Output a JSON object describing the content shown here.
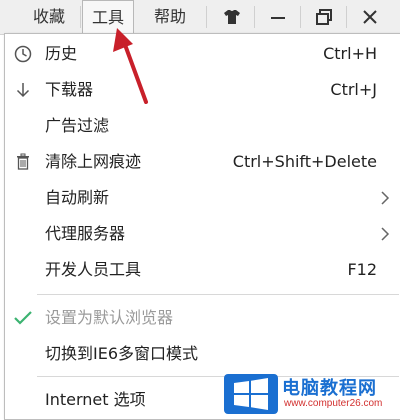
{
  "menubar": {
    "items": [
      {
        "label": "收藏"
      },
      {
        "label": "工具"
      },
      {
        "label": "帮助"
      }
    ],
    "window_buttons": [
      "shirt-icon",
      "minimize-icon",
      "restore-icon",
      "close-icon"
    ]
  },
  "dropdown": {
    "items": [
      {
        "label": "历史",
        "shortcut": "Ctrl+H",
        "icon": "clock-icon"
      },
      {
        "label": "下载器",
        "shortcut": "Ctrl+J",
        "icon": "download-arrow-icon"
      },
      {
        "label": "广告过滤",
        "shortcut": ""
      },
      {
        "label": "清除上网痕迹",
        "shortcut": "Ctrl+Shift+Delete",
        "icon": "trash-icon"
      },
      {
        "label": "自动刷新",
        "shortcut": "",
        "submenu": true
      },
      {
        "label": "代理服务器",
        "shortcut": "",
        "submenu": true
      },
      {
        "label": "开发人员工具",
        "shortcut": "F12"
      },
      {
        "label": "设置为默认浏览器",
        "shortcut": "",
        "disabled": true,
        "icon": "checkmark-icon"
      },
      {
        "label": "切换到IE6多窗口模式",
        "shortcut": ""
      },
      {
        "label": "Internet 选项",
        "shortcut": ""
      }
    ]
  },
  "watermark": {
    "title": "电脑教程网",
    "url": "www.computer26.com"
  },
  "colors": {
    "accent_red": "#c8202a",
    "check_green": "#3cb371",
    "watermark_blue": "#1a6fd1"
  }
}
